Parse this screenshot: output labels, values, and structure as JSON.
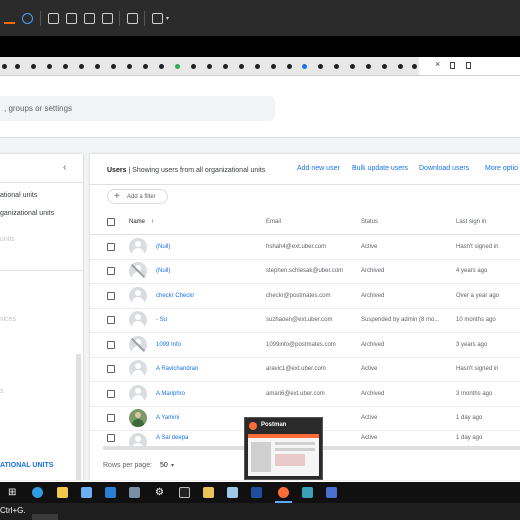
{
  "browser": {
    "tab_strip": {
      "active_tab_close": "×",
      "gmail_favicon": "M"
    }
  },
  "search": {
    "placeholder": ", groups or settings"
  },
  "sidebar": {
    "items": [
      {
        "label": "ational units"
      },
      {
        "label": "ganizational units"
      }
    ],
    "faint_items": [
      {
        "label": "units"
      },
      {
        "label": "vices"
      },
      {
        "label": "s"
      }
    ],
    "footer_label": "ATIONAL UNITS",
    "collapse_glyph": "‹"
  },
  "users": {
    "header": {
      "title_bold": "Users",
      "title_rest": "| Showing users from all organizational units"
    },
    "actions": {
      "add_new_user": "Add new user",
      "bulk_update": "Bulk update users",
      "download": "Download users",
      "more_options": "More optio"
    },
    "filter": {
      "plus": "+",
      "label": "Add a filter"
    },
    "columns": {
      "name": "Name",
      "sort_indicator": "↑",
      "email": "Email",
      "status": "Status",
      "last_sign_in": "Last sign in"
    },
    "rows": [
      {
        "name": "(Null)",
        "email": "hshah4@ext.uber.com",
        "status": "Active",
        "last_sign_in": "Hasn't signed in",
        "avatar": "default"
      },
      {
        "name": "(Null)",
        "email": "stephen.schlesak@uber.com",
        "status": "Archived",
        "last_sign_in": "4 years ago",
        "avatar": "archived"
      },
      {
        "name": "checkr Checkr",
        "email": "checkr@postmates.com",
        "status": "Archived",
        "last_sign_in": "Over a year ago",
        "avatar": "default"
      },
      {
        "name": "- Su",
        "email": "suzhaoen@ext.uber.com",
        "status": "Suspended by admin (8 mo...",
        "last_sign_in": "10 months ago",
        "avatar": "default"
      },
      {
        "name": "1099 Info",
        "email": "1099info@postmates.com",
        "status": "Archived",
        "last_sign_in": "3 years ago",
        "avatar": "archived"
      },
      {
        "name": "A Ravichandran",
        "email": "aravic1@ext.uber.com",
        "status": "Active",
        "last_sign_in": "Hasn't signed in",
        "avatar": "default"
      },
      {
        "name": "A Mariphro",
        "email": "amari6@ext.uber.com",
        "status": "Archived",
        "last_sign_in": "3 months ago",
        "avatar": "default"
      },
      {
        "name": "A Yamini",
        "email": "",
        "status": "Active",
        "last_sign_in": "1 day ago",
        "avatar": "photo"
      },
      {
        "name": "A Sai deepa",
        "email": "",
        "status": "Active",
        "last_sign_in": "1 day ago",
        "avatar": "default"
      }
    ],
    "footer": {
      "rows_per_page_label": "Rows per page:",
      "rows_per_page_value": "50",
      "caret": "▾"
    }
  },
  "taskbar_preview": {
    "title": "Postman"
  },
  "status_hint": "Ctrl+G."
}
